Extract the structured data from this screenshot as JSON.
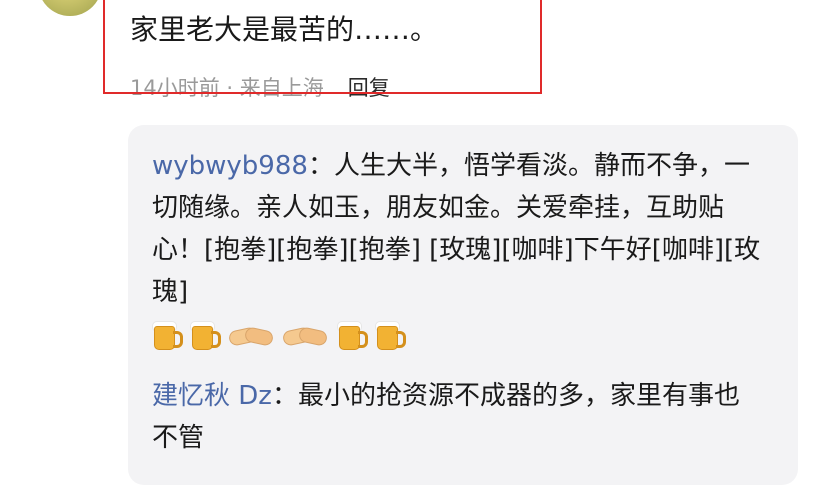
{
  "comment": {
    "text": "家里老大是最苦的……。",
    "meta": "14小时前 · 来自上海",
    "reply_label": "回复"
  },
  "replies": [
    {
      "user": "wybwyb988",
      "separator": "：",
      "text": "人生大半，悟学看淡。静而不争，一切随缘。亲人如玉，朋友如金。关爱牵挂，互助贴心！[抱拳][抱拳][抱拳] [玫瑰][咖啡]下午好[咖啡][玫瑰]",
      "emojis": [
        "beer-icon",
        "beer-icon",
        "handshake-icon",
        "handshake-icon",
        "beer-icon",
        "beer-icon"
      ]
    },
    {
      "user": "建忆秋 Dz",
      "separator": "：",
      "text": "最小的抢资源不成器的多，家里有事也不管"
    }
  ],
  "colors": {
    "highlight": "#e02a2a",
    "username": "#4a68a8",
    "meta": "#9a9a9a",
    "reply_bg": "#f3f3f5"
  }
}
